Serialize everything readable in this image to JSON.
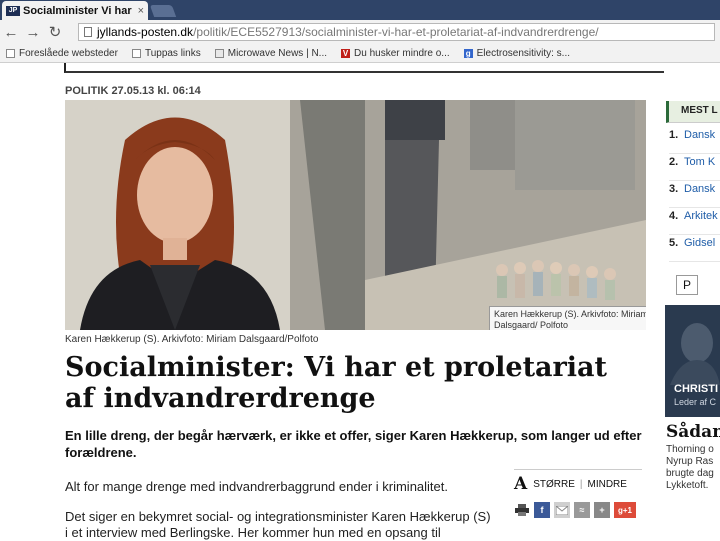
{
  "browser": {
    "tab_favicon": "JP",
    "tab_title": "Socialminister Vi har et p",
    "tab_close": "×",
    "url_host": "jyllands-posten.dk",
    "url_path": "/politik/ECE5527913/socialminister-vi-har-et-proletariat-af-indvandrerdrenge/",
    "bookmarks": [
      {
        "label": "Foreslåede websteder",
        "icon": "page-icon"
      },
      {
        "label": "Tuppas links",
        "icon": "page-icon"
      },
      {
        "label": "Microwave News | N...",
        "icon": "microwave-icon"
      },
      {
        "label": "Du husker mindre o...",
        "icon": "v-icon"
      },
      {
        "label": "Electrosensitivity: s...",
        "icon": "g-icon"
      }
    ]
  },
  "article": {
    "meta": "POLITIK 27.05.13 kl. 06:14",
    "image_caption_overlay": "Karen Hækkerup (S). Arkivfoto: Miriam Dalsgaard/ Polfoto",
    "photo_credit": "Karen Hækkerup (S). Arkivfoto: Miriam Dalsgaard/Polfoto",
    "headline": "Socialminister: Vi har et proletariat af indvandrerdrenge",
    "lead": "En lille dreng, der begår hærværk, er ikke et offer, siger Karen Hækkerup, som langer ud efter forældrene.",
    "paragraph1": "Alt for mange drenge med indvandrerbaggrund ender i kriminalitet.",
    "paragraph2": "Det siger en bekymret social- og integrationsminister Karen Hækkerup (S) i et interview med Berlingske. Her kommer hun med en opsang til"
  },
  "tools": {
    "font_a": "A",
    "larger": "STØRRE",
    "separator": "|",
    "smaller": "MINDRE",
    "gplus": "g+1"
  },
  "sidebar": {
    "most_read_header": "MEST L",
    "most_read": [
      {
        "num": "1.",
        "label": "Dansk"
      },
      {
        "num": "2.",
        "label": "Tom K"
      },
      {
        "num": "3.",
        "label": "Dansk"
      },
      {
        "num": "4.",
        "label": "Arkitek"
      },
      {
        "num": "5.",
        "label": "Gidsel"
      }
    ],
    "p_label": "P",
    "ad_name": "CHRISTI",
    "ad_sub": "Leder af C",
    "sadan_title": "Sådan",
    "sadan_text": "Thorning o Nyrup Ras brugte dag Lykketoft."
  },
  "colors": {
    "tabstrip": "#2f4468",
    "most_read_accent": "#2b6a3a",
    "link": "#1f5da8"
  }
}
